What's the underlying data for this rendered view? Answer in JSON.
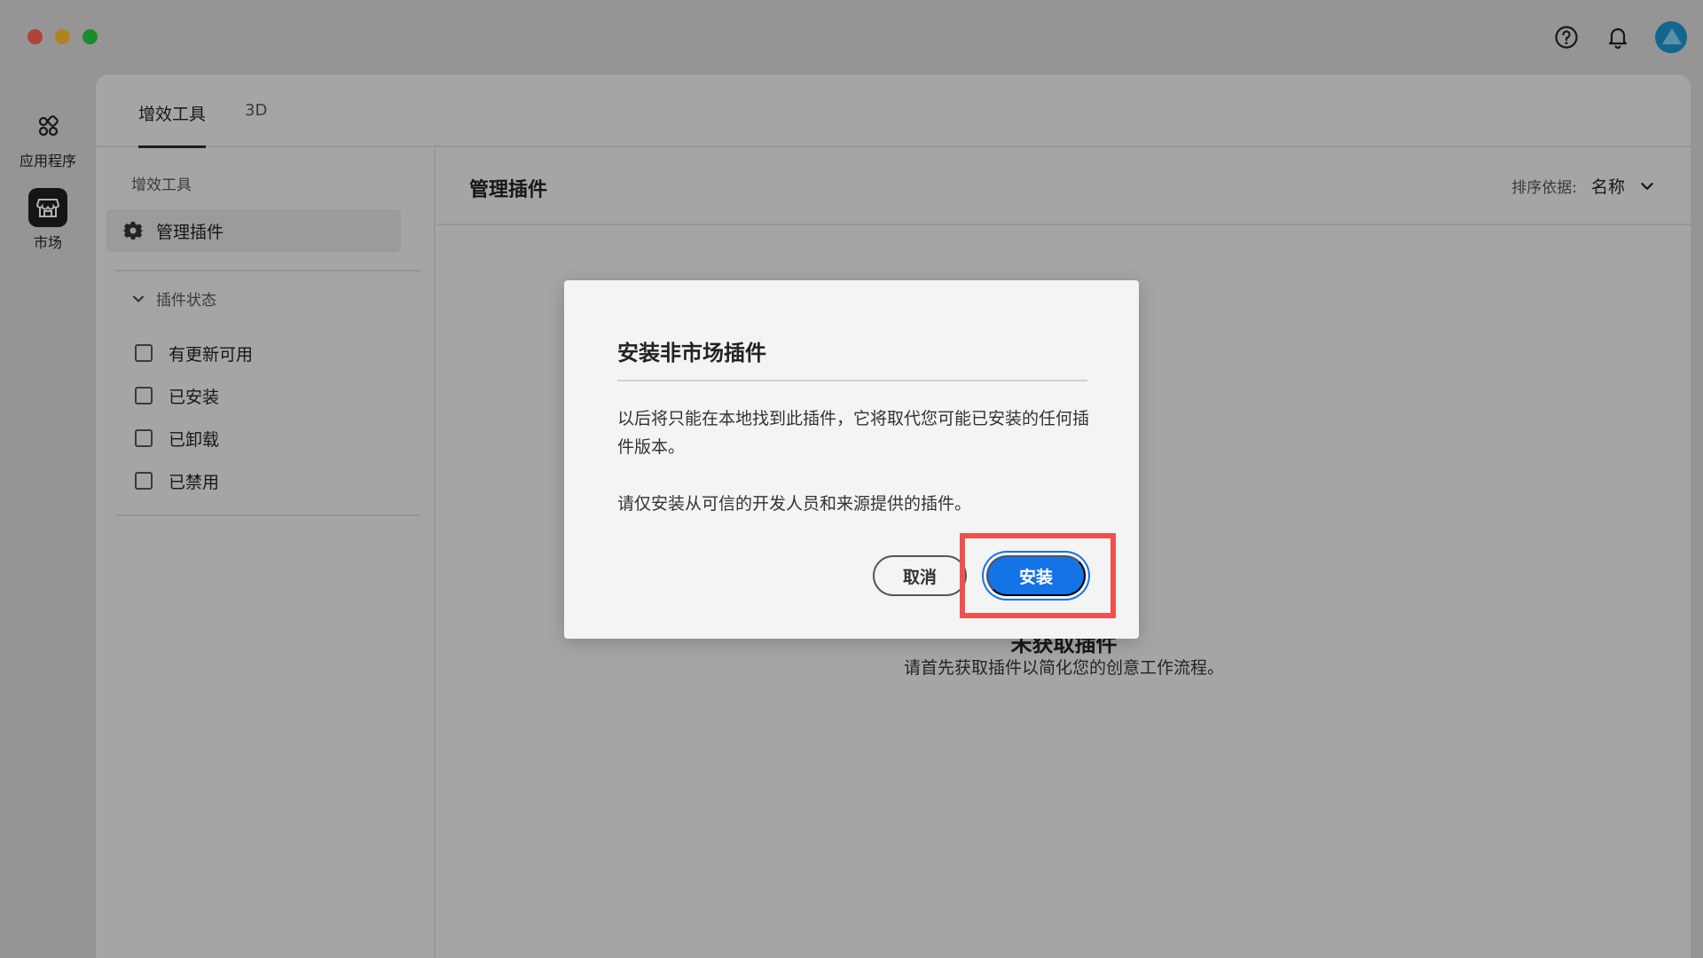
{
  "window": {
    "traffic_lights": [
      "close",
      "minimize",
      "zoom"
    ],
    "top_icons": [
      "help-icon",
      "bell-icon",
      "avatar"
    ]
  },
  "rail": {
    "items": [
      {
        "label": "应用程序",
        "icon": "apps-icon",
        "active": false
      },
      {
        "label": "市场",
        "icon": "store-icon",
        "active": true
      }
    ]
  },
  "tabs": [
    {
      "label": "增效工具",
      "active": true
    },
    {
      "label": "3D",
      "active": false
    }
  ],
  "sidebar": {
    "heading": "增效工具",
    "manage_label": "管理插件",
    "status_heading": "插件状态",
    "filters": [
      "有更新可用",
      "已安装",
      "已卸载",
      "已禁用"
    ]
  },
  "content": {
    "title": "管理插件",
    "sort_label": "排序依据:",
    "sort_value": "名称",
    "empty_title": "未获取插件",
    "empty_desc": "请首先获取插件以简化您的创意工作流程。"
  },
  "dialog": {
    "title": "安装非市场插件",
    "paragraph1": "以后将只能在本地找到此插件，它将取代您可能已安装的任何插件版本。",
    "paragraph2": "请仅安装从可信的开发人员和来源提供的插件。",
    "cancel_label": "取消",
    "install_label": "安装"
  },
  "colors": {
    "accent": "#1473e6",
    "highlight": "#f0514f"
  }
}
